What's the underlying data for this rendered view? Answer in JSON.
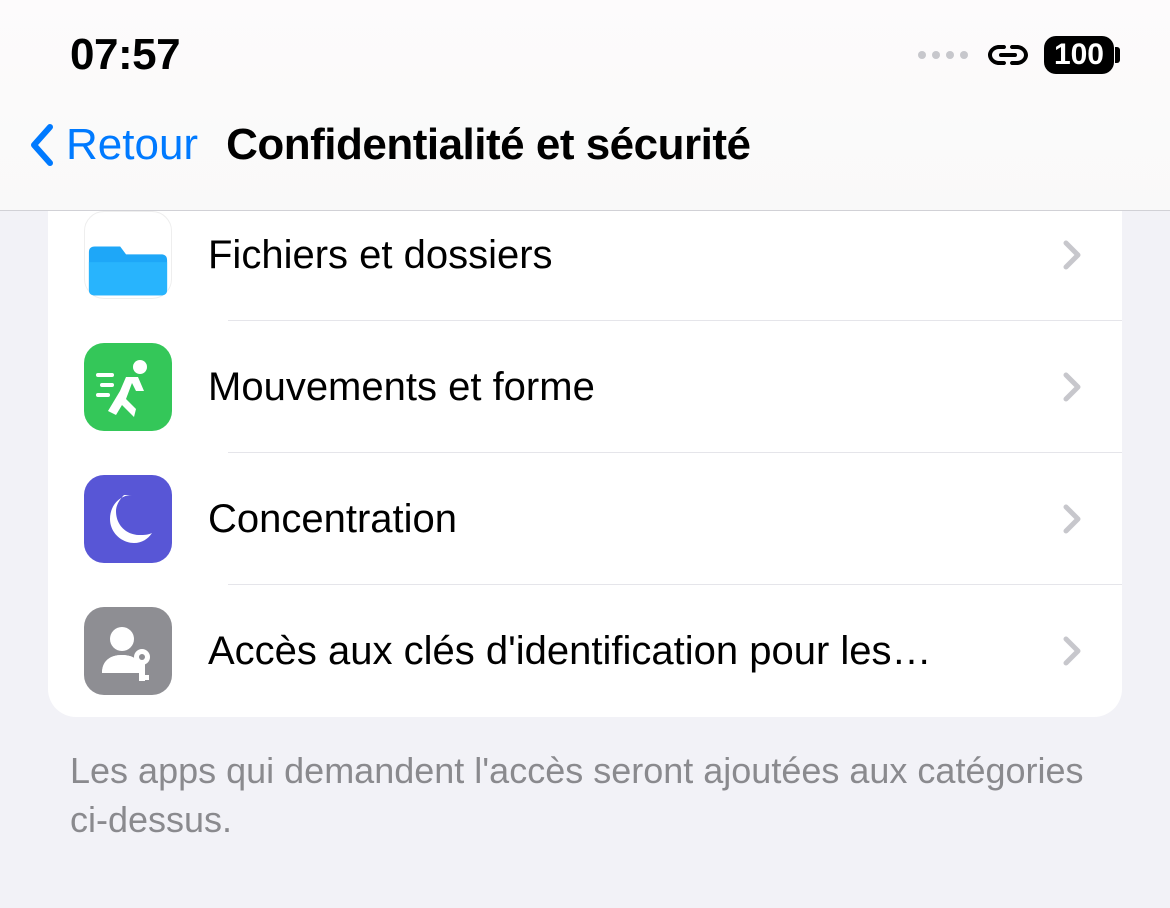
{
  "statusbar": {
    "time": "07:57",
    "battery": "100"
  },
  "nav": {
    "back_label": "Retour",
    "title": "Confidentialité et sécurité"
  },
  "list": {
    "items": [
      {
        "label": "Fichiers et dossiers",
        "icon": "files"
      },
      {
        "label": "Mouvements et forme",
        "icon": "fitness"
      },
      {
        "label": "Concentration",
        "icon": "focus"
      },
      {
        "label": "Accès aux clés d'identification pour les…",
        "icon": "passkey"
      }
    ]
  },
  "footer": {
    "text": "Les apps qui demandent l'accès seront ajoutées aux catégories ci-dessus."
  }
}
